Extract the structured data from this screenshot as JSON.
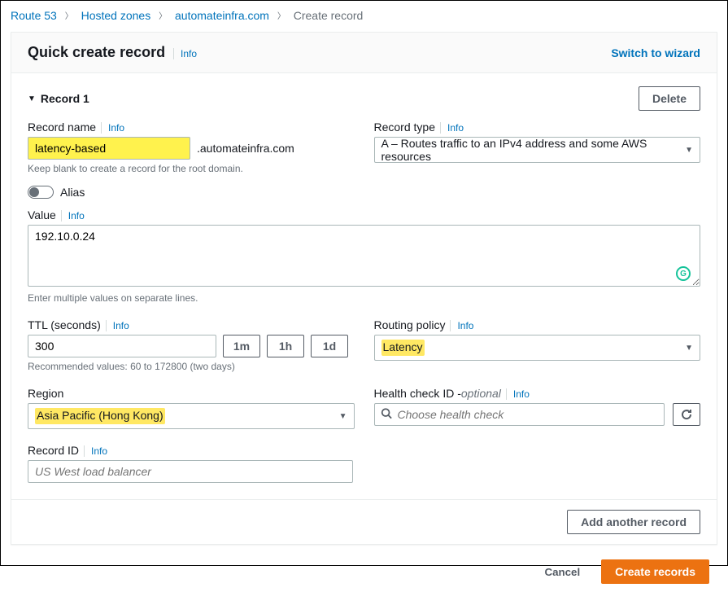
{
  "breadcrumbs": {
    "route53": "Route 53",
    "hosted_zones": "Hosted zones",
    "domain": "automateinfra.com",
    "current": "Create record"
  },
  "header": {
    "title": "Quick create record",
    "info": "Info",
    "switch": "Switch to wizard"
  },
  "record": {
    "section_title": "Record 1",
    "delete": "Delete",
    "name_label": "Record name",
    "name_value": "latency-based",
    "suffix": ".automateinfra.com",
    "name_hint": "Keep blank to create a record for the root domain.",
    "type_label": "Record type",
    "type_value": "A – Routes traffic to an IPv4 address and some AWS resources",
    "alias_label": "Alias",
    "value_label": "Value",
    "value_value": "192.10.0.24",
    "value_hint": "Enter multiple values on separate lines.",
    "ttl_label": "TTL (seconds)",
    "ttl_value": "300",
    "ttl_1m": "1m",
    "ttl_1h": "1h",
    "ttl_1d": "1d",
    "ttl_hint": "Recommended values: 60 to 172800 (two days)",
    "routing_label": "Routing policy",
    "routing_value": "Latency",
    "region_label": "Region",
    "region_value": "Asia Pacific (Hong Kong)",
    "hc_label": "Health check ID - ",
    "hc_optional": "optional",
    "hc_placeholder": "Choose health check",
    "recordid_label": "Record ID",
    "recordid_placeholder": "US West load balancer",
    "add_another": "Add another record",
    "info": "Info"
  },
  "footer": {
    "cancel": "Cancel",
    "create": "Create records"
  }
}
